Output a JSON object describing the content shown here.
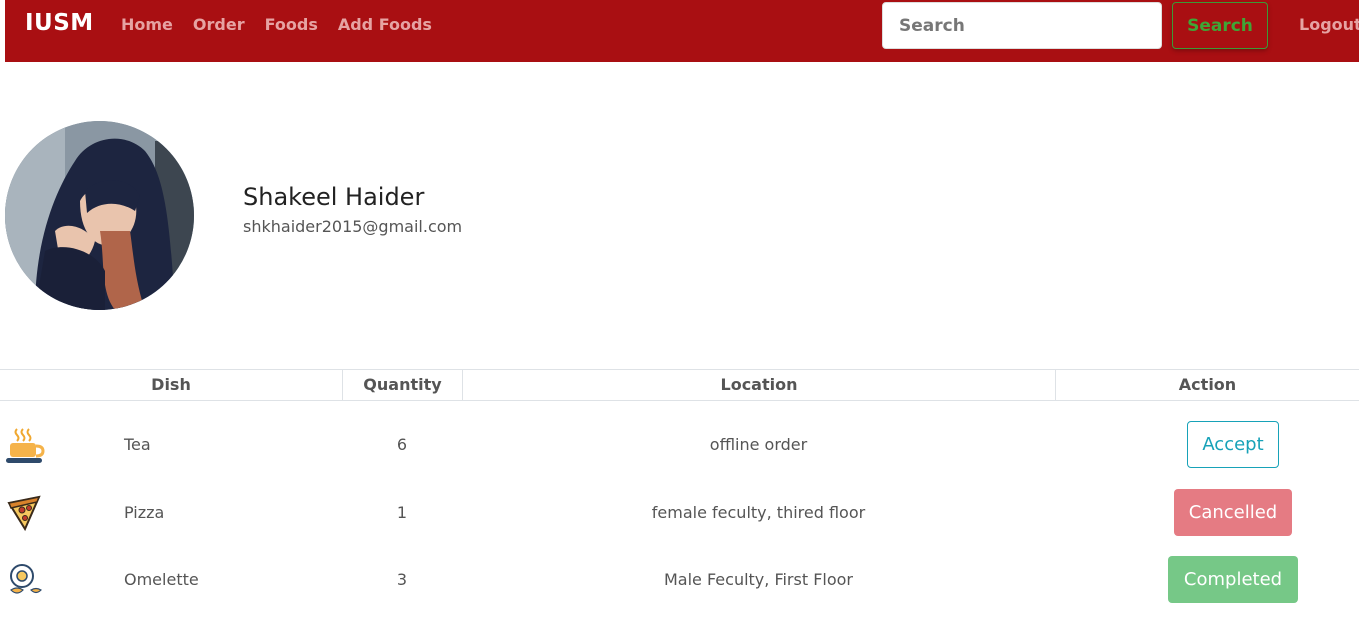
{
  "navbar": {
    "brand": "IUSM",
    "links": [
      "Home",
      "Order",
      "Foods",
      "Add Foods"
    ],
    "search_placeholder": "Search",
    "search_button": "Search",
    "logout": "Logout",
    "colors": {
      "background": "#a90f12",
      "link": "#e6a3a3",
      "search_button": "#3fa636"
    }
  },
  "profile": {
    "name": "Shakeel Haider",
    "email": "shkhaider2015@gmail.com"
  },
  "orders": {
    "columns": [
      "Dish",
      "Quantity",
      "Location",
      "Action"
    ],
    "rows": [
      {
        "icon": "tea-cup-icon",
        "dish": "Tea",
        "quantity": "6",
        "location": "offline order",
        "action": "Accept",
        "action_style": "outline-info"
      },
      {
        "icon": "pizza-slice-icon",
        "dish": "Pizza",
        "quantity": "1",
        "location": "female feculty, thired floor",
        "action": "Cancelled",
        "action_style": "danger"
      },
      {
        "icon": "omelette-icon",
        "dish": "Omelette",
        "quantity": "3",
        "location": "Male Feculty, First Floor",
        "action": "Completed",
        "action_style": "success"
      }
    ]
  }
}
